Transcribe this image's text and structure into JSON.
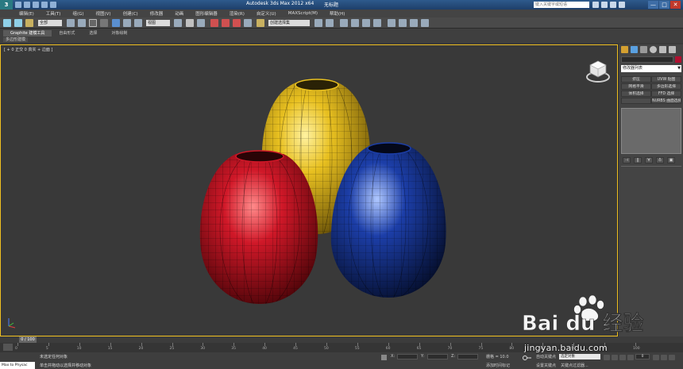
{
  "titlebar": {
    "logo": "3",
    "title": "Autodesk 3ds Max  2012 x64",
    "document": "无标题",
    "search_placeholder": "键入关键字或短语",
    "window_buttons": [
      "—",
      "□",
      "✕"
    ]
  },
  "menu": {
    "items": [
      "编辑(E)",
      "工具(T)",
      "组(G)",
      "视图(V)",
      "创建(C)",
      "修改器",
      "动画",
      "图形编辑器",
      "渲染(R)",
      "自定义(U)",
      "MAXScript(M)",
      "帮助(H)"
    ]
  },
  "toolbar": {
    "selection_filter": "全部",
    "view_select": "视图",
    "named_selection": "创建选择集"
  },
  "ribbon": {
    "tabs": [
      "Graphite 建模工具",
      "自由形式",
      "选择",
      "对象绘制"
    ],
    "subtab": "多边形建模"
  },
  "viewport": {
    "label": "[ + 0 正交 0 真实 + 边面 ]",
    "objects": [
      {
        "name": "yellow-vase",
        "color": "#e8c020"
      },
      {
        "name": "red-vase",
        "color": "#d01828"
      },
      {
        "name": "blue-vase",
        "color": "#1c3ea8"
      }
    ]
  },
  "command_panel": {
    "modifier_list": "修改器列表",
    "buttons": [
      "挤压",
      "UVW 贴图",
      "网格平滑",
      "多边形选择",
      "体积选择",
      "FFD 选择",
      "",
      "NURBS 曲面选择"
    ],
    "object_color": "#b01030"
  },
  "timeline": {
    "current": "0 / 100",
    "ticks": [
      "0",
      "5",
      "10",
      "15",
      "20",
      "25",
      "30",
      "35",
      "40",
      "45",
      "50",
      "55",
      "60",
      "65",
      "70",
      "75",
      "80",
      "85",
      "90",
      "95",
      "100"
    ]
  },
  "status": {
    "maxscript": "Max to Physac",
    "line1": "未选定任何对象",
    "line2": "单击并拖动以选择并移动对象",
    "x_label": "X:",
    "y_label": "Y:",
    "z_label": "Z:",
    "grid": "栅格 = 10.0",
    "add_time_tag": "添加时间标记",
    "auto_key": "自动关键点",
    "set_key": "设置关键点",
    "selection_set": "选定对象",
    "key_filters": "关键点过滤器...",
    "frame": "0"
  },
  "watermark": {
    "brand": "Bai du 经验",
    "url": "jingyan.baidu.com"
  }
}
